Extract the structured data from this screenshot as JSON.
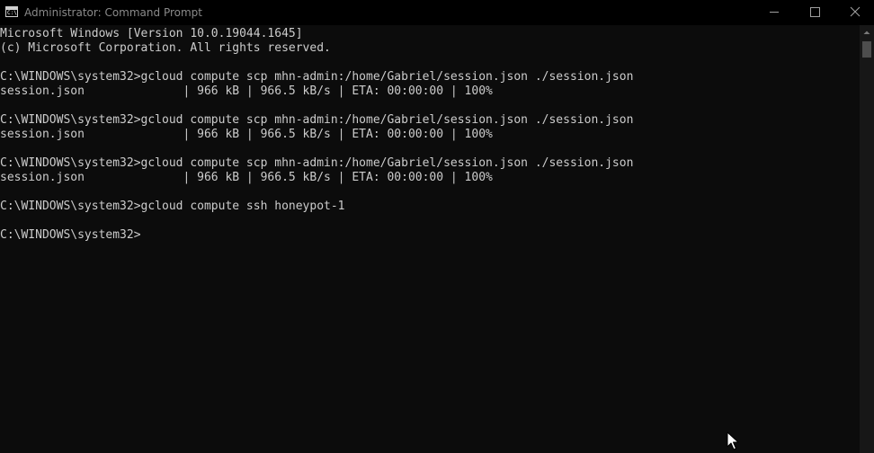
{
  "window": {
    "title": "Administrator: Command Prompt",
    "icon": "cmd-icon"
  },
  "console": {
    "lines": [
      "Microsoft Windows [Version 10.0.19044.1645]",
      "(c) Microsoft Corporation. All rights reserved.",
      "",
      "C:\\WINDOWS\\system32>gcloud compute scp mhn-admin:/home/Gabriel/session.json ./session.json",
      "session.json              | 966 kB | 966.5 kB/s | ETA: 00:00:00 | 100%",
      "",
      "C:\\WINDOWS\\system32>gcloud compute scp mhn-admin:/home/Gabriel/session.json ./session.json",
      "session.json              | 966 kB | 966.5 kB/s | ETA: 00:00:00 | 100%",
      "",
      "C:\\WINDOWS\\system32>gcloud compute scp mhn-admin:/home/Gabriel/session.json ./session.json",
      "session.json              | 966 kB | 966.5 kB/s | ETA: 00:00:00 | 100%",
      "",
      "C:\\WINDOWS\\system32>gcloud compute ssh honeypot-1",
      "",
      "C:\\WINDOWS\\system32>"
    ]
  },
  "colors": {
    "background": "#0c0c0c",
    "text": "#cccccc",
    "titlebar": "#000000",
    "title_text": "#8a8a8a"
  },
  "icons": {
    "minimize": "minimize-icon",
    "maximize": "maximize-icon",
    "close": "close-icon",
    "scroll_up": "scroll-up-arrow-icon",
    "cursor": "mouse-pointer-icon"
  }
}
